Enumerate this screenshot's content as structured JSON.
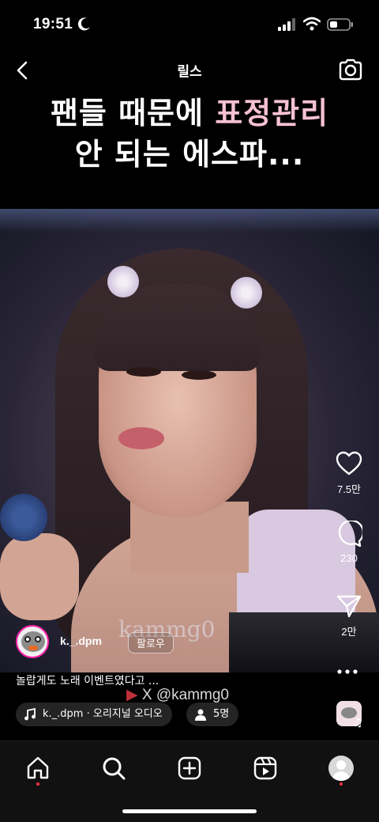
{
  "status_bar": {
    "time": "19:51"
  },
  "header": {
    "title": "릴스"
  },
  "caption": {
    "line1_plain": "팬들 때문에 ",
    "line1_highlight": "표정관리",
    "line2": "안 되는 에스파..."
  },
  "video": {
    "watermark": "kammg0"
  },
  "actions": {
    "likes": "7.5만",
    "comments": "230",
    "shares": "2만"
  },
  "post": {
    "username": "k._.dpm",
    "follow_label": "팔로우",
    "description": "놀랍게도 노래 이벤트였다고 ...",
    "credit": "X @kammg0",
    "audio": "k._.dpm · 오리지널 오디오",
    "people": "5명"
  },
  "colors": {
    "highlight": "#f6c1d3",
    "notification": "#ff3040"
  }
}
